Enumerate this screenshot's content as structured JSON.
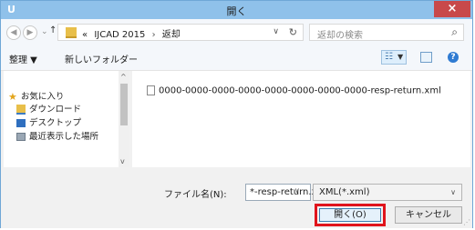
{
  "window": {
    "title": "開く",
    "close_label": "×",
    "app_icon": "U"
  },
  "address": {
    "crumbs": [
      "«",
      "IJCAD 2015",
      "返却"
    ],
    "separator": "›",
    "search_placeholder": "返却の検索"
  },
  "toolbar": {
    "organize_label": "整理 ▼",
    "new_folder_label": "新しいフォルダー"
  },
  "nav": {
    "items": [
      {
        "label": "お気に入り",
        "icon": "star-icon"
      },
      {
        "label": "ダウンロード",
        "icon": "download-folder-icon"
      },
      {
        "label": "デスクトップ",
        "icon": "desktop-icon"
      },
      {
        "label": "最近表示した場所",
        "icon": "recent-places-icon"
      }
    ]
  },
  "files": [
    {
      "name": "0000-0000-0000-0000-0000-0000-0000-0000-resp-return.xml"
    }
  ],
  "bottom": {
    "filename_label": "ファイル名(N):",
    "filename_value": "*-resp-return.xml",
    "filetype_value": "XML(*.xml)",
    "open_label": "開く(O)",
    "cancel_label": "キャンセル"
  },
  "colors": {
    "highlight": "#e0141c",
    "titlebar": "#8fc1ea",
    "close": "#c8494a"
  }
}
